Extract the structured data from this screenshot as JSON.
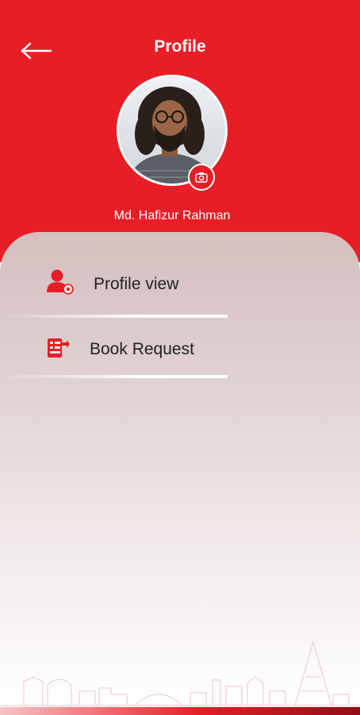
{
  "header": {
    "title": "Profile",
    "back_icon": "arrow-left-icon",
    "background_color": "#e81e27"
  },
  "profile": {
    "name": "Md. Hafizur Rahman",
    "camera_icon": "camera-icon"
  },
  "menu": {
    "items": [
      {
        "label": "Profile view",
        "icon": "user-view-icon"
      },
      {
        "label": "Book Request",
        "icon": "book-request-icon"
      }
    ]
  },
  "theme": {
    "accent": "#e81e27"
  }
}
